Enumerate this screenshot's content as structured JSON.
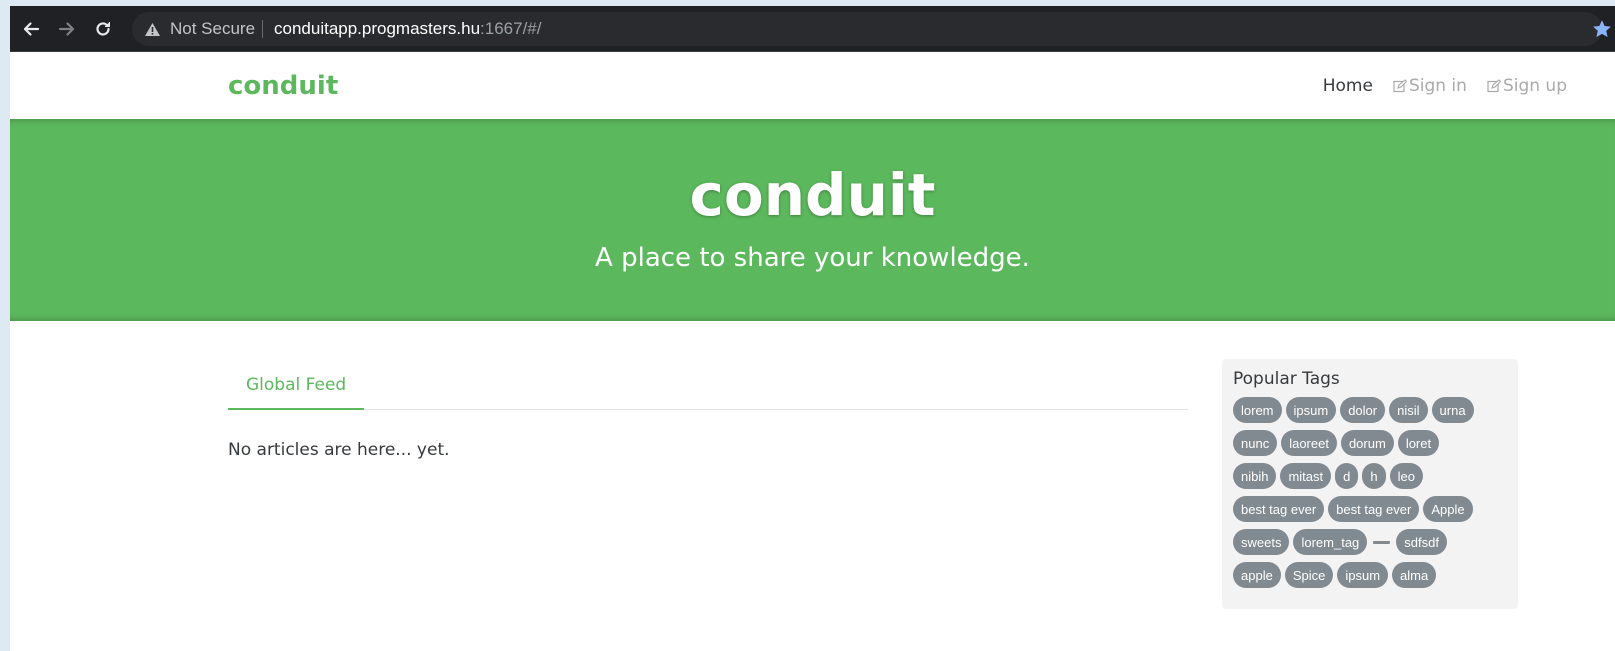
{
  "browser": {
    "not_secure_label": "Not Secure",
    "url_host": "conduitapp.progmasters.hu",
    "url_rest": ":1667/#/",
    "icons": [
      "back-arrow-icon",
      "forward-arrow-icon",
      "reload-icon",
      "warning-icon",
      "star-icon"
    ],
    "colors": {
      "bar": "#202124",
      "star": "#8ab4f8"
    }
  },
  "navbar": {
    "brand": "conduit",
    "links": [
      {
        "label": "Home",
        "active": true
      },
      {
        "label": "Sign in",
        "icon": "edit-icon",
        "active": false
      },
      {
        "label": "Sign up",
        "icon": "edit-icon",
        "active": false
      }
    ]
  },
  "banner": {
    "title": "conduit",
    "subtitle": "A place to share your knowledge."
  },
  "feed": {
    "tabs": [
      {
        "label": "Global Feed",
        "active": true
      }
    ],
    "empty_message": "No articles are here... yet."
  },
  "sidebar": {
    "title": "Popular Tags",
    "tag_rows": [
      [
        "lorem",
        "ipsum",
        "dolor",
        "nisil",
        "urna"
      ],
      [
        "nunc",
        "laoreet",
        "dorum",
        "loret"
      ],
      [
        "nibih",
        "mitast",
        "d",
        "h",
        "leo"
      ],
      [
        "best tag ever",
        "best tag ever",
        "Apple"
      ],
      [
        "sweets",
        "lorem_tag",
        "",
        "sdfsdf"
      ],
      [
        "apple",
        "Spice",
        "ipsum",
        "alma"
      ]
    ]
  },
  "colors": {
    "brand": "#5cb85c",
    "tag": "#818a91",
    "text": "#373a3c",
    "muted": "#aaaaaa",
    "sidebar_bg": "#f3f3f3"
  }
}
